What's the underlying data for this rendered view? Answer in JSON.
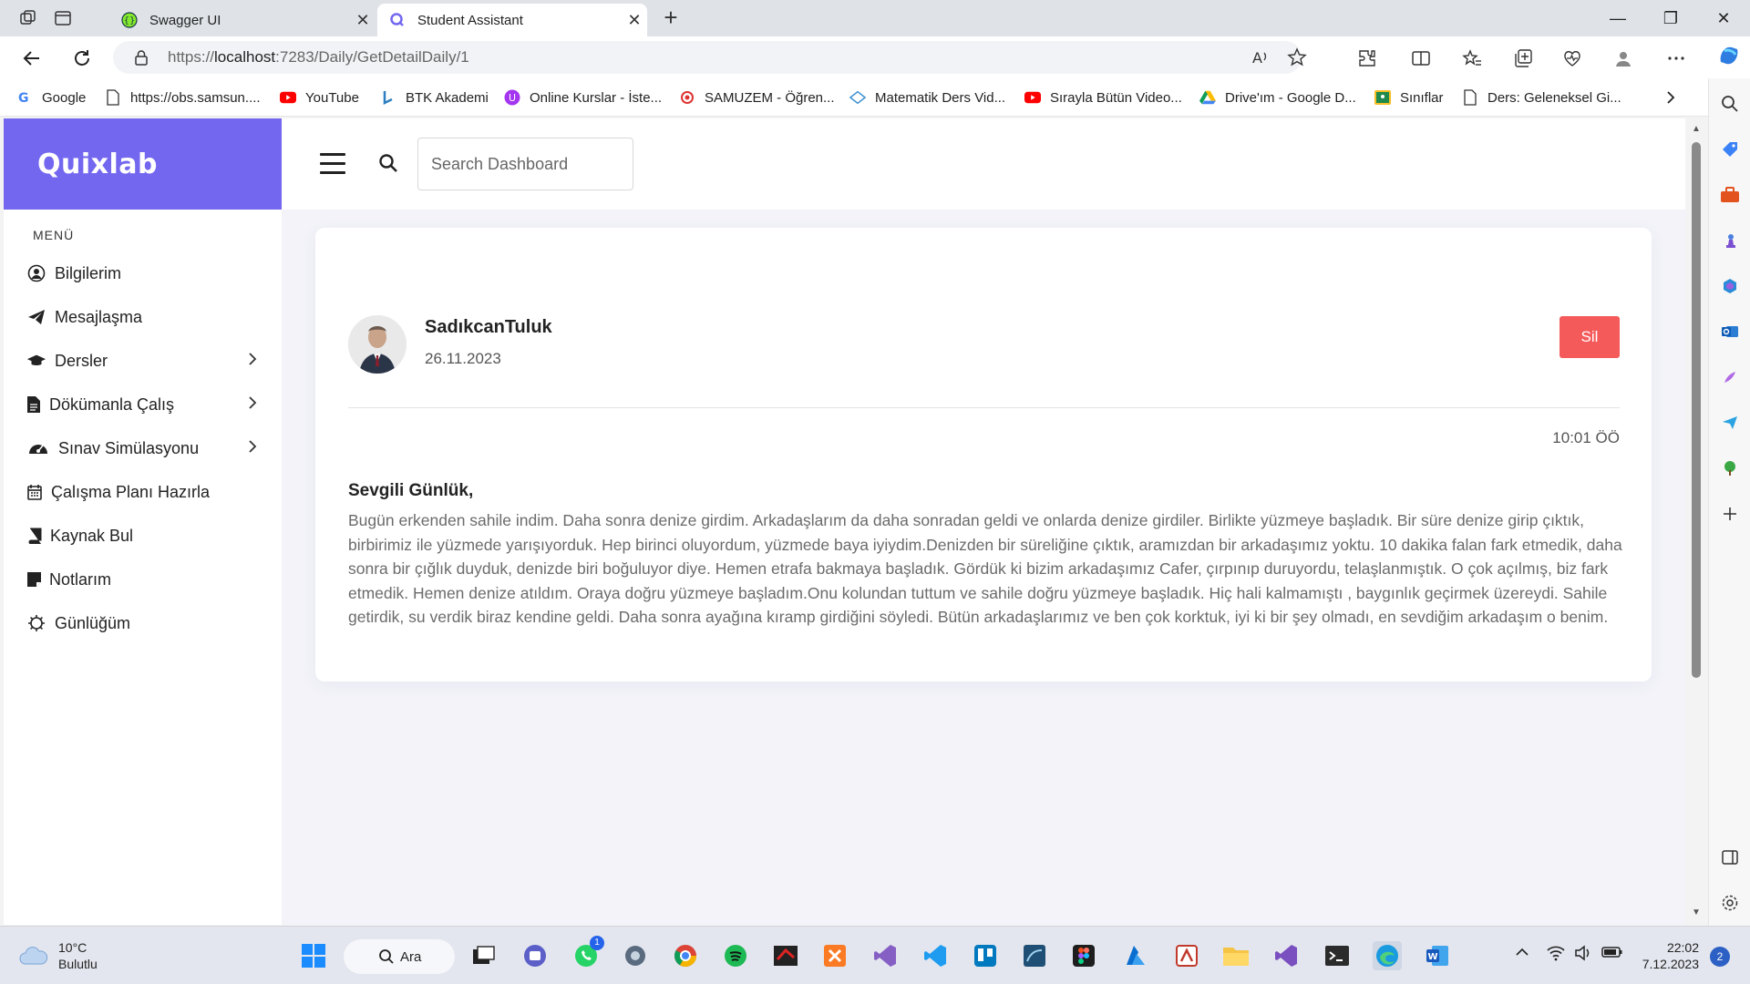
{
  "browser": {
    "tabs": [
      {
        "title": "Swagger UI",
        "active": false
      },
      {
        "title": "Student Assistant",
        "active": true
      }
    ],
    "url_prefix": "https://",
    "url_host": "localhost",
    "url_rest": ":7283/Daily/GetDetailDaily/1",
    "bookmarks": [
      {
        "label": "Google",
        "icon": "google-icon"
      },
      {
        "label": "https://obs.samsun....",
        "icon": "page-icon"
      },
      {
        "label": "YouTube",
        "icon": "youtube-icon"
      },
      {
        "label": "BTK Akademi",
        "icon": "btk-icon"
      },
      {
        "label": "Online Kurslar - İste...",
        "icon": "udemy-icon"
      },
      {
        "label": "SAMUZEM - Öğren...",
        "icon": "samuzem-icon"
      },
      {
        "label": "Matematik Ders Vid...",
        "icon": "math-icon"
      },
      {
        "label": "Sırayla Bütün Video...",
        "icon": "youtube-icon"
      },
      {
        "label": "Drive'ım - Google D...",
        "icon": "drive-icon"
      },
      {
        "label": "Sınıflar",
        "icon": "classroom-icon"
      },
      {
        "label": "Ders: Geleneksel Gi...",
        "icon": "page-icon"
      }
    ]
  },
  "app": {
    "brand": "Quixlab",
    "menu_title": "MENÜ",
    "menu": [
      {
        "label": "Bilgilerim",
        "icon": "user-circle-icon",
        "has_children": false
      },
      {
        "label": "Mesajlaşma",
        "icon": "paper-plane-icon",
        "has_children": false
      },
      {
        "label": "Dersler",
        "icon": "graduation-cap-icon",
        "has_children": true
      },
      {
        "label": "Dökümanla Çalış",
        "icon": "document-icon",
        "has_children": true
      },
      {
        "label": "Sınav Simülasyonu",
        "icon": "gauge-icon",
        "has_children": true
      },
      {
        "label": "Çalışma Planı Hazırla",
        "icon": "calendar-icon",
        "has_children": false
      },
      {
        "label": "Kaynak Bul",
        "icon": "book-icon",
        "has_children": false
      },
      {
        "label": "Notlarım",
        "icon": "note-icon",
        "has_children": false
      },
      {
        "label": "Günlüğüm",
        "icon": "gear-icon",
        "has_children": false
      }
    ],
    "search_placeholder": "Search Dashboard"
  },
  "post": {
    "author": "SadıkcanTuluk",
    "date": "26.11.2023",
    "delete_label": "Sil",
    "time": "10:01 ÖÖ",
    "greeting": "Sevgili Günlük,",
    "body": "Bugün erkenden sahile indim. Daha sonra denize girdim. Arkadaşlarım da daha sonradan geldi ve onlarda denize girdiler. Birlikte yüzmeye başladık. Bir süre denize girip çıktık, birbirimiz ile yüzmede yarışıyorduk. Hep birinci oluyordum, yüzmede baya iyiydim.Denizden bir süreliğine çıktık, aramızdan bir arkadaşımız yoktu. 10 dakika falan fark etmedik, daha sonra bir çığlık duyduk, denizde biri boğuluyor diye. Hemen etrafa bakmaya başladık. Gördük ki bizim arkadaşımız Cafer, çırpınıp duruyordu, telaşlanmıştık. O çok açılmış, biz fark etmedik. Hemen denize atıldım. Oraya doğru yüzmeye başladım.Onu kolundan tuttum ve sahile doğru yüzmeye başladık. Hiç hali kalmamıştı , baygınlık geçirmek üzereydi. Sahile getirdik, su verdik biraz kendine geldi. Daha sonra ayağına kıramp girdiğini söyledi. Bütün arkadaşlarımız ve ben çok korktuk, iyi ki bir şey olmadı, en sevdiğim arkadaşım o benim."
  },
  "taskbar": {
    "temperature": "10°C",
    "weather": "Bulutlu",
    "search_label": "Ara",
    "time": "22:02",
    "date": "7.12.2023",
    "notifications": "2",
    "whatsapp_badge": "1"
  },
  "colors": {
    "brand": "#7367f0",
    "danger": "#f55a5a"
  }
}
